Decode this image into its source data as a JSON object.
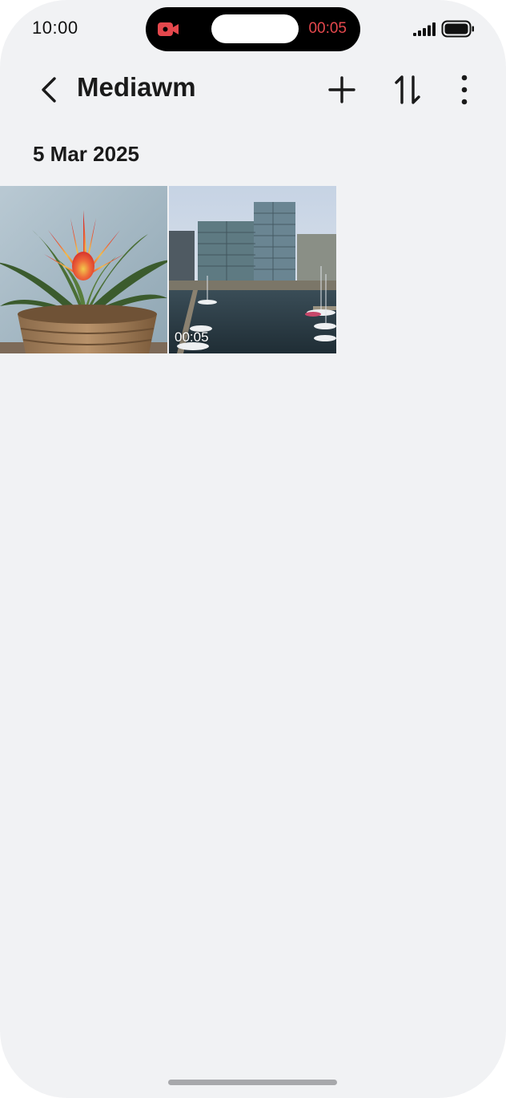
{
  "status_bar": {
    "time": "10:00",
    "recording_timer": "00:05"
  },
  "app_bar": {
    "title": "Mediawm",
    "icons": [
      "back-chevron",
      "plus",
      "sort-arrows",
      "more-vertical"
    ]
  },
  "gallery": {
    "sections": [
      {
        "date": "5 Mar 2025",
        "items": [
          {
            "type": "photo",
            "subject": "potted bromeliad plant"
          },
          {
            "type": "video",
            "subject": "harbor with office buildings",
            "duration": "00:05"
          }
        ]
      }
    ]
  },
  "colors": {
    "background": "#f1f2f4",
    "text": "#1a1a1a",
    "record_red": "#e5484d"
  }
}
